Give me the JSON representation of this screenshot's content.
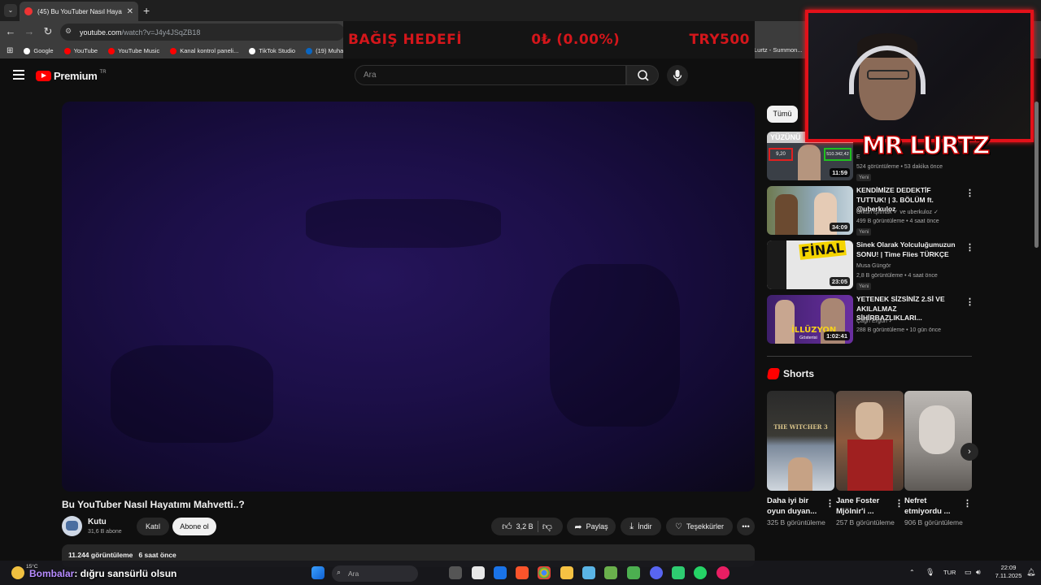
{
  "browser": {
    "tab_title": "(45) Bu YouTuber Nasıl Hayatım",
    "tab_close": "✕",
    "new_tab": "+",
    "url_host": "youtube.com",
    "url_path": "/watch?v=J4y4JSqZB18",
    "bookmarks": [
      {
        "label": "Google",
        "color": "#ffffff"
      },
      {
        "label": "YouTube",
        "color": "#ff0000"
      },
      {
        "label": "YouTube Music",
        "color": "#ff0000"
      },
      {
        "label": "Kanal kontrol paneli...",
        "color": "#ff0000"
      },
      {
        "label": "TikTok Studio",
        "color": "#ffffff"
      },
      {
        "label": "(19) Muha",
        "color": "#0a66c2"
      }
    ],
    "bookmark_right": "Lurtz - Summon..."
  },
  "donation": {
    "label": "BAĞIŞ HEDEFİ",
    "amount": "0₺ (0.00%)",
    "goal": "TRY500"
  },
  "youtube": {
    "brand": "Premium",
    "country": "TR",
    "search_placeholder": "Ara"
  },
  "video": {
    "title": "Bu YouTuber Nasıl Hayatımı Mahvetti..?",
    "channel": "Kutu",
    "subscribers": "31,6 B abone",
    "join_label": "Katıl",
    "subscribe_label": "Abone ol",
    "likes": "3,2 B",
    "share_label": "Paylaş",
    "download_label": "İndir",
    "thanks_label": "Teşekkürler",
    "views": "11.244 görüntüleme",
    "time_ago": "6 saat önce"
  },
  "sidebar": {
    "chip_all": "Tümü",
    "recommendations": [
      {
        "title": "YÜZÜNÜ",
        "channel": "E",
        "meta": "524 görüntüleme • 53 dakika önce",
        "badge": "Yeni",
        "duration": "11:59",
        "overlay_left": "9,20",
        "overlay_right": "510.342,42",
        "thumb_color": "#3a3f46"
      },
      {
        "title": "KENDİMİZE DEDEKTİF TUTTUK! | 3. BÖLÜM ft. @uberkuloz",
        "channel": "Orkun Işıtmak ✓ ve uberkuloz ✓",
        "meta": "499 B görüntüleme • 4 saat önce",
        "badge": "Yeni",
        "duration": "34:09",
        "thumb_color": "#5a6c48"
      },
      {
        "title": "Sinek Olarak Yolculuğumuzun SONU! | Time Flies TÜRKÇE",
        "channel": "Musa Güngör",
        "meta": "2,8 B görüntüleme • 4 saat önce",
        "badge": "Yeni",
        "duration": "23:05",
        "overlay_text": "FİNAL",
        "thumb_color": "#e7e7e7"
      },
      {
        "title": "YETENEK SİZSİNİZ 2.Sİ VE AKILALMAZ SİHİRBAZLIKLARI...",
        "channel": "Çağrı Ergün ✓",
        "meta": "288 B görüntüleme • 10 gün önce",
        "badge": "",
        "duration": "1:02:41",
        "overlay_text": "İLLÜZYON",
        "overlay_sub": "Gösterisi",
        "thumb_color": "#5b2a8a"
      }
    ],
    "shorts_label": "Shorts",
    "shorts": [
      {
        "title": "Daha iyi bir oyun duyan...",
        "views": "325 B görüntüleme",
        "thumb_text": "THE WITCHER 3",
        "thumb_color": "#3b3a34"
      },
      {
        "title": "Jane Foster Mjölnir'i ...",
        "views": "257 B görüntüleme",
        "thumb_color": "#6b4b3b"
      },
      {
        "title": "Nefret etmiyordu ...",
        "views": "906 B görüntüleme",
        "thumb_color": "#8e8a86"
      }
    ]
  },
  "stream": {
    "streamer_name": "MR LURTZ",
    "chat_user": "Bombalar",
    "chat_message": ": dığru sansürlü olsun"
  },
  "taskbar": {
    "weather": "15°C",
    "search_placeholder": "Ara",
    "language": "TUR",
    "time": "22:09",
    "date": "7.11.2025"
  },
  "colors": {
    "accent": "#ff0000",
    "donation_text": "#d4161b",
    "webcam_border": "#e3111a",
    "chat_user": "#b68bff"
  }
}
